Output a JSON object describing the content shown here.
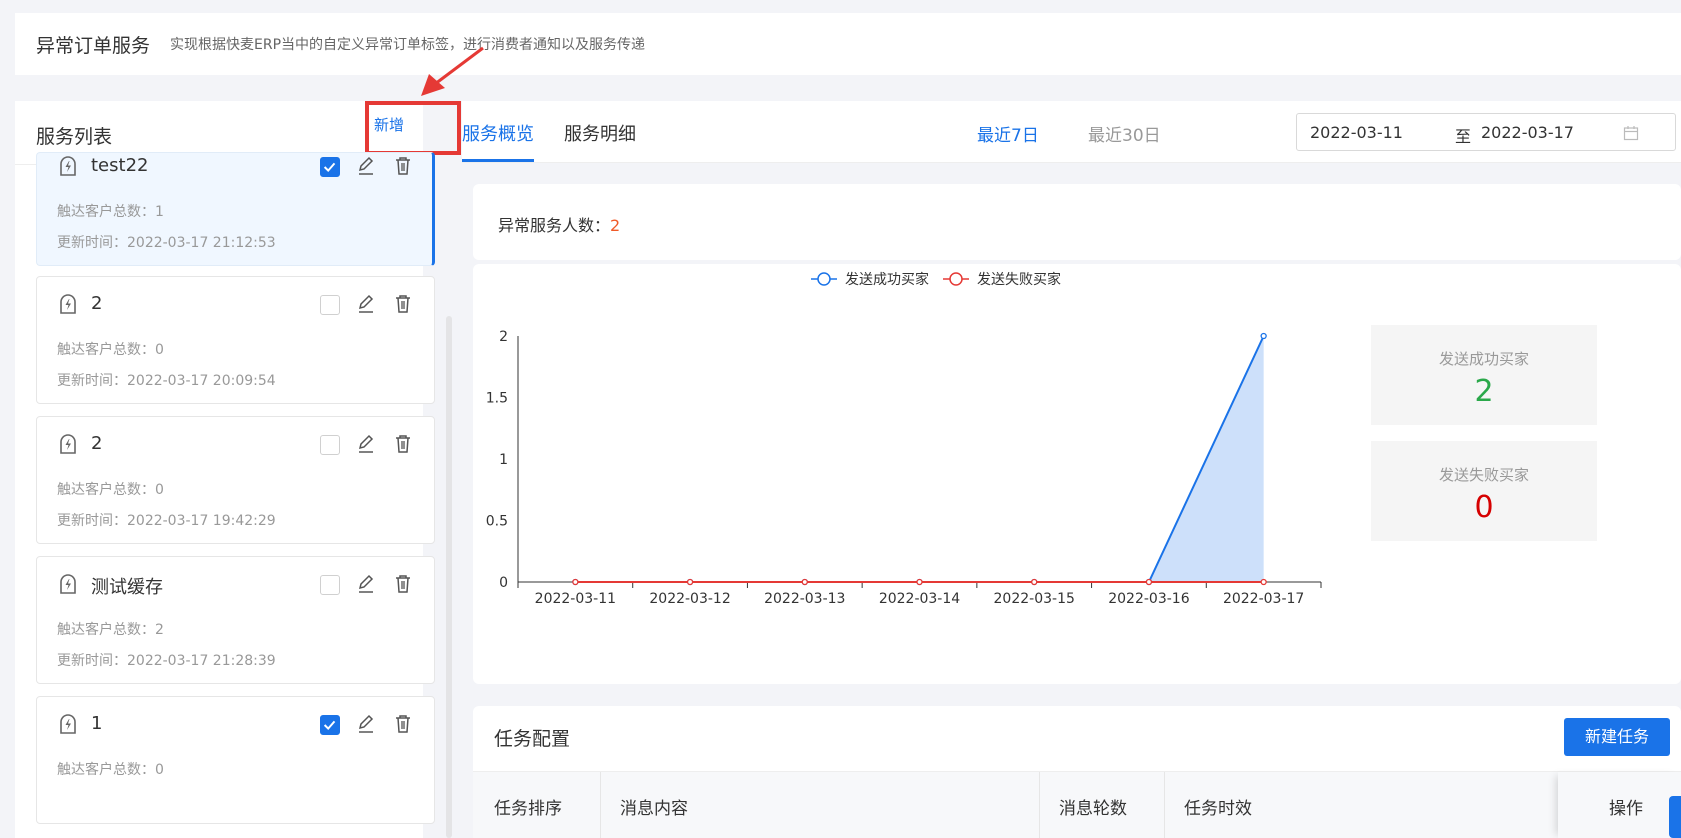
{
  "header": {
    "title": "异常订单服务",
    "description": "实现根据快麦ERP当中的自定义异常订单标签，进行消费者通知以及服务传递"
  },
  "service_list": {
    "title": "服务列表",
    "add_label": "新增",
    "items": [
      {
        "name": "test22",
        "count": "触达客户总数：1",
        "updated": "更新时间：2022-03-17 21:12:53",
        "checked": true,
        "active": true
      },
      {
        "name": "2",
        "count": "触达客户总数：0",
        "updated": "更新时间：2022-03-17 20:09:54",
        "checked": false,
        "active": false
      },
      {
        "name": "2",
        "count": "触达客户总数：0",
        "updated": "更新时间：2022-03-17 19:42:29",
        "checked": false,
        "active": false
      },
      {
        "name": "测试缓存",
        "count": "触达客户总数：2",
        "updated": "更新时间：2022-03-17 21:28:39",
        "checked": false,
        "active": false
      },
      {
        "name": "1",
        "count": "触达客户总数：0",
        "updated": "",
        "checked": true,
        "active": false
      }
    ]
  },
  "tabs": {
    "overview": "服务概览",
    "detail": "服务明细",
    "last7": "最近7日",
    "last30": "最近30日",
    "date_start": "2022-03-11",
    "date_sep": "至",
    "date_end": "2022-03-17"
  },
  "stats": {
    "label": "异常服务人数：",
    "value": "2",
    "success_label": "发送成功买家",
    "success_value": "2",
    "fail_label": "发送失败买家",
    "fail_value": "0"
  },
  "chart_data": {
    "type": "line",
    "categories": [
      "2022-03-11",
      "2022-03-12",
      "2022-03-13",
      "2022-03-14",
      "2022-03-15",
      "2022-03-16",
      "2022-03-17"
    ],
    "series": [
      {
        "name": "发送成功买家",
        "values": [
          0,
          0,
          0,
          0,
          0,
          0,
          2
        ],
        "color": "#1a73e8",
        "area": true
      },
      {
        "name": "发送失败买家",
        "values": [
          0,
          0,
          0,
          0,
          0,
          0,
          0
        ],
        "color": "#e53935",
        "area": false
      }
    ],
    "yticks": [
      "0",
      "0.5",
      "1",
      "1.5",
      "2"
    ],
    "ylim": [
      0,
      2
    ],
    "legend": "top-center",
    "grid": false
  },
  "tasks": {
    "title": "任务配置",
    "new_label": "新建任务",
    "columns": [
      "任务排序",
      "消息内容",
      "消息轮数",
      "任务时效",
      "操作"
    ]
  },
  "colors": {
    "accent": "#1a73e8",
    "success": "#2aa84a",
    "fail": "#d60000",
    "highlight": "#f05a28",
    "annotation": "#e53935"
  }
}
